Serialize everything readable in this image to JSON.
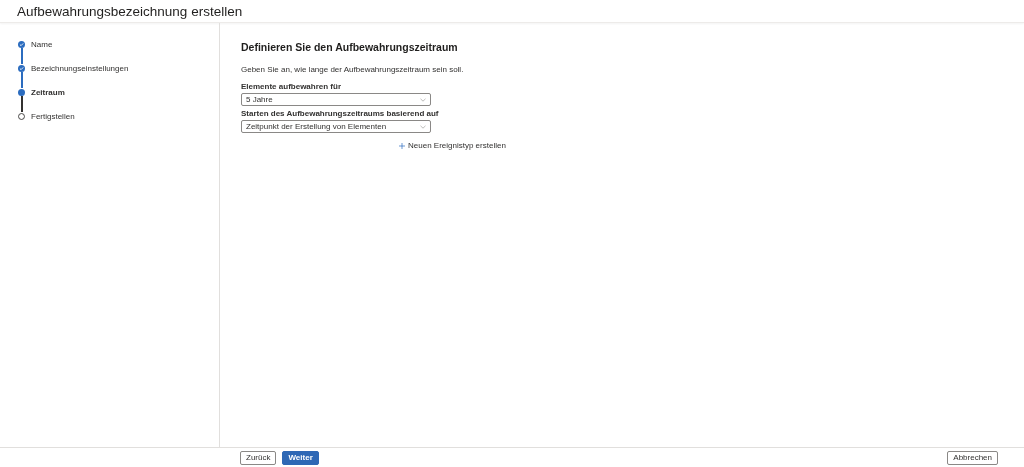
{
  "header": {
    "title": "Aufbewahrungsbezeichnung erstellen"
  },
  "steps": [
    {
      "label": "Name",
      "completed": true,
      "selected": false
    },
    {
      "label": "Bezeichnungseinstellungen",
      "completed": true,
      "selected": false
    },
    {
      "label": "Zeitraum",
      "completed": false,
      "selected": true
    },
    {
      "label": "Fertigstellen",
      "completed": false,
      "selected": false
    }
  ],
  "main": {
    "heading": "Definieren Sie den Aufbewahrungszeitraum",
    "description": "Geben Sie an, wie lange der Aufbewahrungszeitraum sein soll.",
    "fields": [
      {
        "label": "Elemente aufbewahren für",
        "value": "5 Jahre"
      },
      {
        "label": "Starten des Aufbewahrungszeitraums basierend auf",
        "value": "Zeitpunkt der Erstellung von Elementen"
      }
    ],
    "add_link": "Neuen Ereignistyp erstellen"
  },
  "footer": {
    "back": "Zurück",
    "next": "Weiter",
    "cancel": "Abbrechen"
  }
}
